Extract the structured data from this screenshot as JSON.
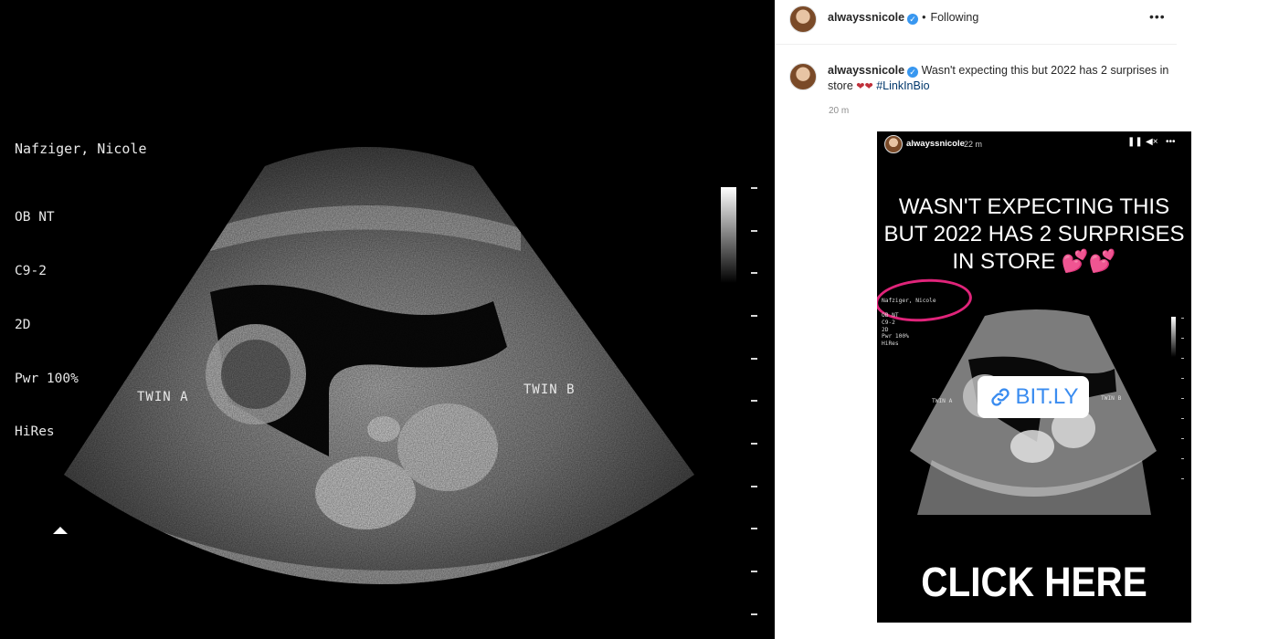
{
  "ultrasound": {
    "patient_name": "Nafziger, Nicole",
    "settings": [
      "OB NT",
      "C9-2",
      "2D",
      "Pwr 100%",
      "HiRes"
    ],
    "twin_a_label": "TWIN A",
    "twin_b_label": "TWIN B"
  },
  "post": {
    "username": "alwayssnicole",
    "follow_status": "Following",
    "more_icon": "more-horizontal-icon",
    "caption": {
      "username": "alwayssnicole",
      "text": "Wasn't expecting this but 2022 has 2 surprises in store",
      "hearts": "❤❤",
      "hashtag": "#LinkInBio"
    },
    "timestamp": "20 m"
  },
  "story": {
    "username": "alwayssnicole",
    "time": "22 m",
    "headline": "WASN'T EXPECTING THIS BUT 2022 HAS 2 SURPRISES IN STORE",
    "headline_emoji": "💕💕",
    "patient_name": "Nafziger, Nicole",
    "settings": "OB NT\nC9-2\n2D\nPwr 100%\nHiRes",
    "twin_a_label": "TWIN A",
    "twin_b_label": "TWIN B",
    "link_text": "BIT.LY",
    "cta": "CLICK HERE"
  },
  "colors": {
    "verified_badge": "#3897f0",
    "hashtag": "#00376b",
    "annotation_circle": "#e0247a",
    "link_text": "#3a8cf0"
  }
}
